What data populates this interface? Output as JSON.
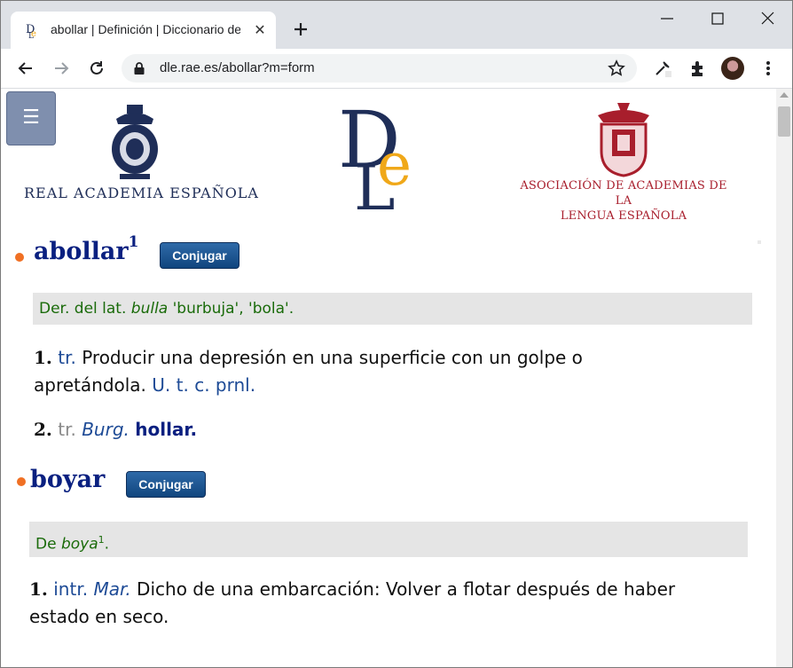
{
  "browser": {
    "tab_title": "abollar | Definición | Diccionario de la lengua española",
    "url": "dle.rae.es/abollar?m=form",
    "colors": {
      "titlebar": "#dee1e6",
      "omnibox": "#f1f3f4"
    }
  },
  "page": {
    "rae_name": "REAL ACADEMIA ESPAÑOLA",
    "asale_line1": "ASOCIACIÓN DE ACADEMIAS DE LA",
    "asale_line2": "LENGUA ESPAÑOLA",
    "menu_icon": "☰",
    "conjugar_label": "Conjugar"
  },
  "entries": [
    {
      "lemma": "abollar",
      "sup": "1",
      "etym_prefix": "Der. del lat. ",
      "etym_word": "bulla",
      "etym_rest": " 'burbuja', 'bola'.",
      "senses": [
        {
          "num": "1.",
          "abbr": "tr.",
          "text": " Producir una depresión en una superficie con un golpe o apretándola. ",
          "abbr2": "U. t. c. prnl."
        },
        {
          "num": "2.",
          "abbr": "tr.",
          "region": "Burg.",
          "link": "hollar",
          "end": "."
        }
      ]
    },
    {
      "lemma": "boyar",
      "etym_prefix": "De ",
      "etym_word": "boya",
      "etym_sup": "1",
      "etym_rest": ".",
      "senses": [
        {
          "num": "1.",
          "abbr": "intr.",
          "region": "Mar.",
          "text": " Dicho de una embarcación: Volver a flotar después de haber estado en seco."
        }
      ]
    }
  ],
  "colors": {
    "lemma": "#0a2080",
    "etymology_text": "#1a6b0a",
    "etymology_bg": "#e5e5e5",
    "bullet": "#f07024",
    "abbr": "#1e4b96",
    "rae_brand": "#1f2e58",
    "asale_brand": "#a81e2c",
    "dle_gold": "#f0a819"
  }
}
